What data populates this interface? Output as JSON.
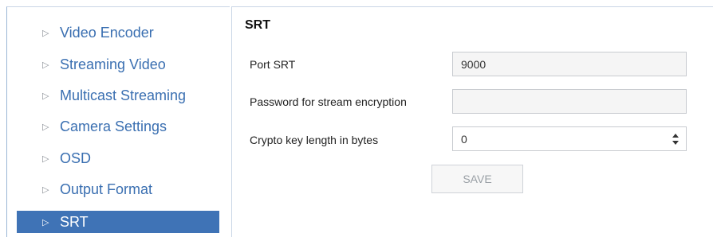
{
  "sidebar": {
    "items": [
      {
        "label": "Video Encoder",
        "active": false
      },
      {
        "label": "Streaming Video",
        "active": false
      },
      {
        "label": "Multicast Streaming",
        "active": false
      },
      {
        "label": "Camera Settings",
        "active": false
      },
      {
        "label": "OSD",
        "active": false
      },
      {
        "label": "Output Format",
        "active": false
      },
      {
        "label": "SRT",
        "active": true
      }
    ]
  },
  "panel": {
    "title": "SRT",
    "fields": {
      "port": {
        "label": "Port SRT",
        "value": "9000"
      },
      "password": {
        "label": "Password for stream encryption",
        "value": ""
      },
      "crypto": {
        "label": "Crypto key length in bytes",
        "value": "0"
      }
    },
    "save_label": "SAVE"
  },
  "colors": {
    "accent": "#3f73b6",
    "link": "#3a6fb1"
  },
  "icons": {
    "arrow": "triangle-right-icon",
    "select": "updown-arrows-icon"
  }
}
